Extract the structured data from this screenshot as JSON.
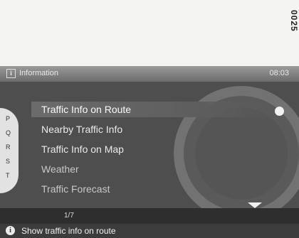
{
  "page_code": "0025",
  "header": {
    "title": "Information",
    "clock": "08:03",
    "info_icon": "info-box-icon"
  },
  "index_letters": [
    "P",
    "Q",
    "R",
    "S",
    "T"
  ],
  "menu": {
    "items": [
      {
        "label": "Traffic Info on Route",
        "selected": true
      },
      {
        "label": "Nearby Traffic Info",
        "selected": false
      },
      {
        "label": "Traffic Info on Map",
        "selected": false
      },
      {
        "label": "Weather",
        "selected": false
      },
      {
        "label": "Traffic Forecast",
        "selected": false
      }
    ]
  },
  "pager": {
    "text": "1/7"
  },
  "status": {
    "icon": "info-circle-icon",
    "text": "Show traffic info on route"
  },
  "colors": {
    "screen_bg": "#4e4e4e",
    "selected_bg": "#6b6b6b",
    "text": "#eaeaea"
  }
}
